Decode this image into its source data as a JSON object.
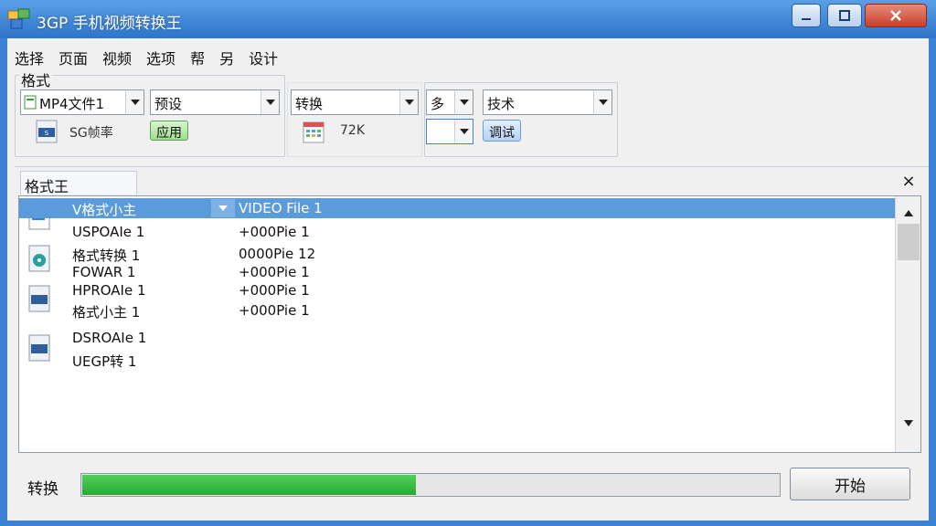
{
  "window": {
    "title": "3GP 手机视频转换王",
    "accent": "#3a82d4"
  },
  "menu": [
    "选择",
    "页面",
    "视频",
    "选项",
    "帮",
    "另",
    "设计"
  ],
  "format_group": {
    "label": "格式",
    "combo_format": "MP4文件1",
    "combo_preset": "预设",
    "file_size_text": "SG帧率",
    "apply_button": "应用"
  },
  "mid_group": {
    "combo_convert": "转换",
    "info_text": "72K"
  },
  "right_group": {
    "combo_small": "多",
    "combo_option": "技术",
    "combo_empty": "",
    "settings_button": "调试"
  },
  "list": {
    "tab_label": "格式王",
    "close_glyph": "×",
    "rows": [
      {
        "name": "V格式小主",
        "value": "VIDEO File 1",
        "selected": true
      },
      {
        "name": "USPOAIe 1",
        "value": "+000Pie 1",
        "selected": false
      },
      {
        "name": "格式转换 1",
        "value": "0000Pie 12",
        "selected": false
      },
      {
        "name": "FOWAR 1",
        "value": "+000Pie 1",
        "selected": false
      },
      {
        "name": "HPROAIe 1",
        "value": "+000Pie 1",
        "selected": false
      },
      {
        "name": "格式小主 1",
        "value": "+000Pie 1",
        "selected": false
      },
      {
        "name": "DSROAIe 1",
        "value": "",
        "selected": false
      },
      {
        "name": "UEGP转 1",
        "value": "",
        "selected": false
      }
    ]
  },
  "status": {
    "label": "转换",
    "progress": 0.48,
    "start_button": "开始"
  }
}
